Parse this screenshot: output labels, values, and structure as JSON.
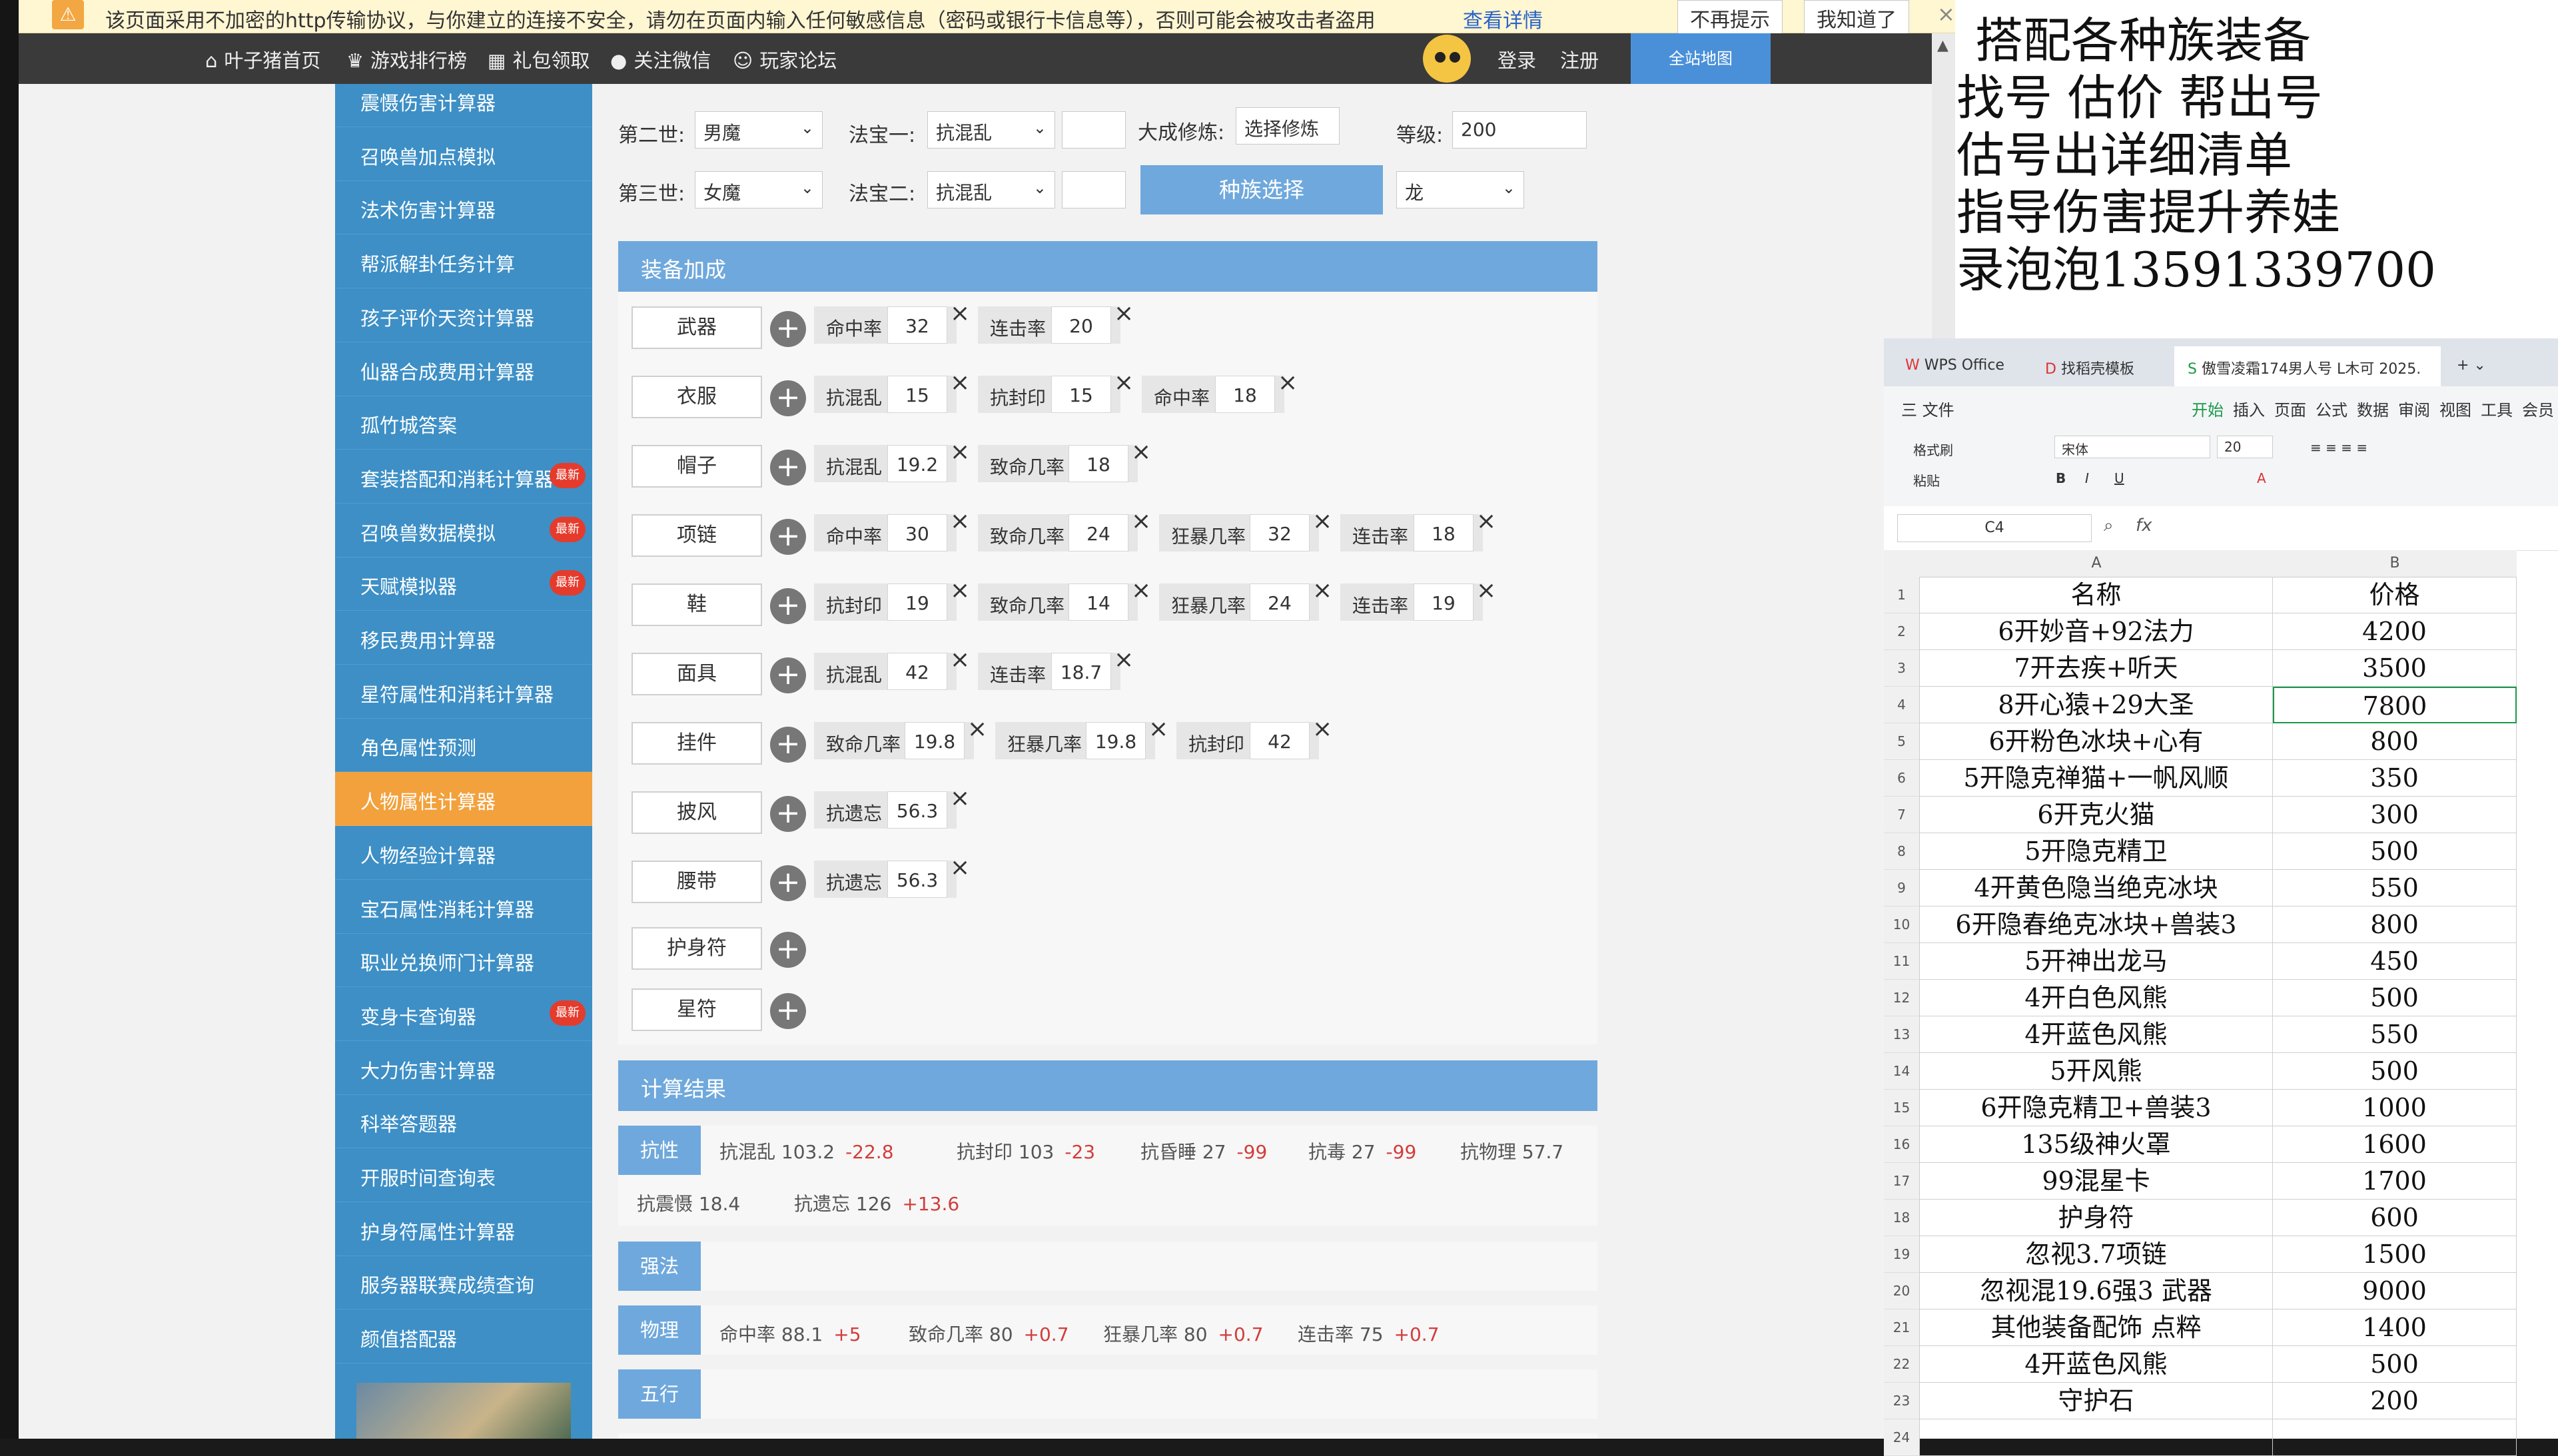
{
  "warning_bar": {
    "text": "该页面采用不加密的http传输协议，与你建立的连接不安全，请勿在页面内输入任何敏感信息（密码或银行卡信息等），否则可能会被攻击者盗用",
    "link": "查看详情",
    "btn_no_remind": "不再提示",
    "btn_ok": "我知道了",
    "close": "×"
  },
  "nav": {
    "items": [
      "叶子猪首页",
      "游戏排行榜",
      "礼包领取",
      "关注微信",
      "玩家论坛"
    ],
    "login": "登录",
    "register": "注册",
    "site_map": "全站地图"
  },
  "sidebar": {
    "items": [
      {
        "label": "震慑伤害计算器",
        "badge": ""
      },
      {
        "label": "召唤兽加点模拟",
        "badge": ""
      },
      {
        "label": "法术伤害计算器",
        "badge": ""
      },
      {
        "label": "帮派解卦任务计算",
        "badge": ""
      },
      {
        "label": "孩子评价天资计算器",
        "badge": ""
      },
      {
        "label": "仙器合成费用计算器",
        "badge": ""
      },
      {
        "label": "孤竹城答案",
        "badge": ""
      },
      {
        "label": "套装搭配和消耗计算器",
        "badge": "最新"
      },
      {
        "label": "召唤兽数据模拟",
        "badge": "最新"
      },
      {
        "label": "天赋模拟器",
        "badge": "最新"
      },
      {
        "label": "移民费用计算器",
        "badge": ""
      },
      {
        "label": "星符属性和消耗计算器",
        "badge": ""
      },
      {
        "label": "角色属性预测",
        "badge": ""
      },
      {
        "label": "人物属性计算器",
        "badge": "",
        "active": true
      },
      {
        "label": "人物经验计算器",
        "badge": ""
      },
      {
        "label": "宝石属性消耗计算器",
        "badge": ""
      },
      {
        "label": "职业兑换师门计算器",
        "badge": ""
      },
      {
        "label": "变身卡查询器",
        "badge": "最新"
      },
      {
        "label": "大力伤害计算器",
        "badge": ""
      },
      {
        "label": "科举答题器",
        "badge": ""
      },
      {
        "label": "开服时间查询表",
        "badge": ""
      },
      {
        "label": "护身符属性计算器",
        "badge": ""
      },
      {
        "label": "服务器联赛成绩查询",
        "badge": ""
      },
      {
        "label": "颜值搭配器",
        "badge": ""
      }
    ]
  },
  "form": {
    "row2": {
      "label": "第二世:",
      "value": "男魔",
      "fabao_label": "法宝一:",
      "fabao_value": "抗混乱",
      "fabao_input": "",
      "xiulian_label": "大成修炼:",
      "xiulian_btn": "选择修炼",
      "level_label": "等级:",
      "level_value": "200"
    },
    "row3": {
      "label": "第三世:",
      "value": "女魔",
      "fabao_label": "法宝二:",
      "fabao_value": "抗混乱",
      "fabao_input": "",
      "race_btn": "种族选择",
      "race_value": "龙"
    }
  },
  "equip": {
    "title": "装备加成",
    "rows": [
      {
        "name": "武器",
        "attrs": [
          {
            "n": "命中率",
            "v": "32"
          },
          {
            "n": "连击率",
            "v": "20"
          }
        ]
      },
      {
        "name": "衣服",
        "attrs": [
          {
            "n": "抗混乱",
            "v": "15"
          },
          {
            "n": "抗封印",
            "v": "15"
          },
          {
            "n": "命中率",
            "v": "18"
          }
        ]
      },
      {
        "name": "帽子",
        "attrs": [
          {
            "n": "抗混乱",
            "v": "19.2"
          },
          {
            "n": "致命几率",
            "v": "18"
          }
        ]
      },
      {
        "name": "项链",
        "attrs": [
          {
            "n": "命中率",
            "v": "30"
          },
          {
            "n": "致命几率",
            "v": "24"
          },
          {
            "n": "狂暴几率",
            "v": "32"
          },
          {
            "n": "连击率",
            "v": "18"
          }
        ]
      },
      {
        "name": "鞋",
        "attrs": [
          {
            "n": "抗封印",
            "v": "19"
          },
          {
            "n": "致命几率",
            "v": "14"
          },
          {
            "n": "狂暴几率",
            "v": "24"
          },
          {
            "n": "连击率",
            "v": "19"
          }
        ]
      },
      {
        "name": "面具",
        "attrs": [
          {
            "n": "抗混乱",
            "v": "42"
          },
          {
            "n": "连击率",
            "v": "18.7"
          }
        ]
      },
      {
        "name": "挂件",
        "attrs": [
          {
            "n": "致命几率",
            "v": "19.8"
          },
          {
            "n": "狂暴几率",
            "v": "19.8"
          },
          {
            "n": "抗封印",
            "v": "42"
          }
        ]
      },
      {
        "name": "披风",
        "attrs": [
          {
            "n": "抗遗忘",
            "v": "56.3"
          }
        ]
      },
      {
        "name": "腰带",
        "attrs": [
          {
            "n": "抗遗忘",
            "v": "56.3"
          }
        ]
      },
      {
        "name": "护身符",
        "attrs": []
      },
      {
        "name": "星符",
        "attrs": []
      }
    ]
  },
  "results": {
    "title": "计算结果",
    "kangxing_label": "抗性",
    "kangxing": [
      {
        "t": "抗混乱 103.2",
        "d": "-22.8"
      },
      {
        "t": "抗封印 103",
        "d": "-23"
      },
      {
        "t": "抗昏睡 27",
        "d": "-99"
      },
      {
        "t": "抗毒 27",
        "d": "-99"
      },
      {
        "t": "抗物理 57.7",
        "d": ""
      }
    ],
    "kangxing2": [
      {
        "t": "抗震慑 18.4",
        "d": ""
      },
      {
        "t": "抗遗忘 126",
        "d": "+13.6"
      }
    ],
    "qiangfa_label": "强法",
    "wuli_label": "物理",
    "wuli": [
      {
        "t": "命中率 88.1",
        "d": "+5"
      },
      {
        "t": "致命几率 80",
        "d": "+0.7"
      },
      {
        "t": "狂暴几率 80",
        "d": "+0.7"
      },
      {
        "t": "连击率 75",
        "d": "+0.7"
      }
    ],
    "wuxing_label": "五行"
  },
  "ad": {
    "lines": [
      "搭配各种族装备",
      "找号  估价  帮出号",
      " 估号出详细清单",
      "指导伤害提升养娃",
      "录泡泡13591339700"
    ]
  },
  "wps": {
    "tabs": [
      "WPS Office",
      "找稻壳模板",
      "傲雪凌霜174男人号 L木可 2025."
    ],
    "menu": [
      "三 文件",
      "开始",
      "插入",
      "页面",
      "公式",
      "数据",
      "审阅",
      "视图",
      "工具",
      "会员"
    ],
    "ribbon": {
      "format_painter": "格式刷",
      "paste": "粘贴",
      "font": "宋体",
      "size": "20"
    },
    "namebox": "C4",
    "fx": "fx",
    "columns": [
      "A",
      "B"
    ],
    "rows": [
      [
        "名称",
        "价格"
      ],
      [
        "6开妙音+92法力",
        "4200"
      ],
      [
        "7开去疾+听天",
        "3500"
      ],
      [
        "8开心猿+29大圣",
        "7800"
      ],
      [
        "6开粉色冰块+心有",
        "800"
      ],
      [
        "5开隐克禅猫+一帆风顺",
        "350"
      ],
      [
        "6开克火猫",
        "300"
      ],
      [
        "5开隐克精卫",
        "500"
      ],
      [
        "4开黄色隐当绝克冰块",
        "550"
      ],
      [
        "6开隐春绝克冰块+兽装3",
        "800"
      ],
      [
        "5开神出龙马",
        "450"
      ],
      [
        "4开白色风熊",
        "500"
      ],
      [
        "4开蓝色风熊",
        "550"
      ],
      [
        "5开风熊",
        "500"
      ],
      [
        "6开隐克精卫+兽装3",
        "1000"
      ],
      [
        "135级神火罩",
        "1600"
      ],
      [
        "99混星卡",
        "1700"
      ],
      [
        "护身符",
        "600"
      ],
      [
        "忽视3.7项链",
        "1500"
      ],
      [
        "忽视混19.6强3 武器",
        "9000"
      ],
      [
        "其他装备配饰  点粹",
        "1400"
      ],
      [
        "4开蓝色风熊",
        "500"
      ],
      [
        "守护石",
        "200"
      ],
      [
        "",
        ""
      ]
    ]
  }
}
